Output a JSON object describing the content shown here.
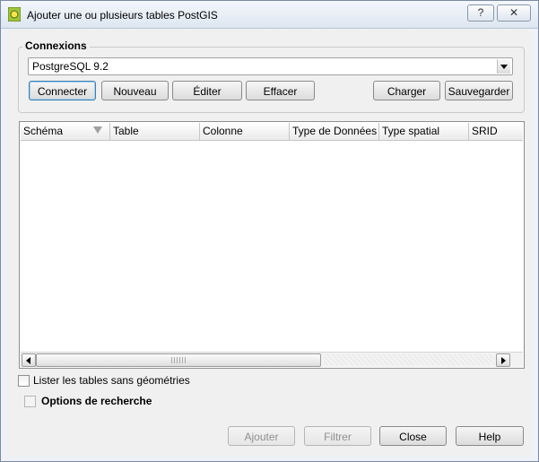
{
  "window": {
    "title": "Ajouter une ou plusieurs tables PostGIS",
    "help_button": "?",
    "close_button": "✕"
  },
  "connections": {
    "group_title": "Connexions",
    "selected": "PostgreSQL 9.2",
    "buttons": {
      "connect": "Connecter",
      "new": "Nouveau",
      "edit": "Éditer",
      "delete": "Effacer",
      "load": "Charger",
      "save": "Sauvegarder"
    }
  },
  "table": {
    "columns": [
      "Schéma",
      "Table",
      "Colonne",
      "Type de Données",
      "Type spatial",
      "SRID"
    ],
    "rows": []
  },
  "options": {
    "list_no_geometry": "Lister les tables sans géométries",
    "search_options": "Options de recherche"
  },
  "footer": {
    "add": "Ajouter",
    "filter": "Filtrer",
    "close": "Close",
    "help": "Help"
  }
}
